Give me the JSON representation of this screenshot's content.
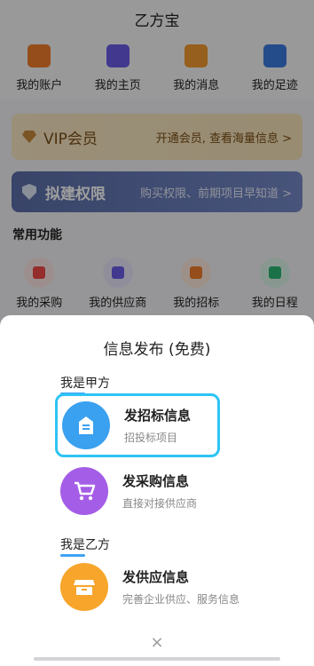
{
  "app": {
    "title": "乙方宝"
  },
  "quick_links": [
    {
      "label": "我的账户",
      "icon": "wallet-icon",
      "color": "#f07c2c"
    },
    {
      "label": "我的主页",
      "icon": "id-card-icon",
      "color": "#6b5ce7"
    },
    {
      "label": "我的消息",
      "icon": "message-icon",
      "color": "#f29a30"
    },
    {
      "label": "我的足迹",
      "icon": "footprint-icon",
      "color": "#3a7be0"
    }
  ],
  "vip": {
    "title": "VIP会员",
    "desc": "开通会员, 查看海量信息 >"
  },
  "permission": {
    "title": "拟建权限",
    "desc": "购买权限、前期项目早知道 >"
  },
  "common": {
    "title": "常用功能",
    "items": [
      {
        "label": "我的采购",
        "icon": "shopping-bag-icon",
        "color": "#f04a4a",
        "bg": "#fde5e5"
      },
      {
        "label": "我的供应商",
        "icon": "store-icon",
        "color": "#6b5ce7",
        "bg": "#e8e5fb"
      },
      {
        "label": "我的招标",
        "icon": "briefcase-icon",
        "color": "#f07c2c",
        "bg": "#fde9dc"
      },
      {
        "label": "我的日程",
        "icon": "calendar-icon",
        "color": "#2bb673",
        "bg": "#dcf5e8"
      }
    ]
  },
  "sheet": {
    "title": "信息发布 (免费)",
    "section_a": "我是甲方",
    "section_b": "我是乙方",
    "options": [
      {
        "title": "发招标信息",
        "subtitle": "招投标项目",
        "icon": "bid-document-icon",
        "color": "#3aa0f0"
      },
      {
        "title": "发采购信息",
        "subtitle": "直接对接供应商",
        "icon": "cart-icon",
        "color": "#a45de6"
      },
      {
        "title": "发供应信息",
        "subtitle": "完善企业供应、服务信息",
        "icon": "storefront-icon",
        "color": "#f7a52b"
      }
    ],
    "close": "×"
  }
}
